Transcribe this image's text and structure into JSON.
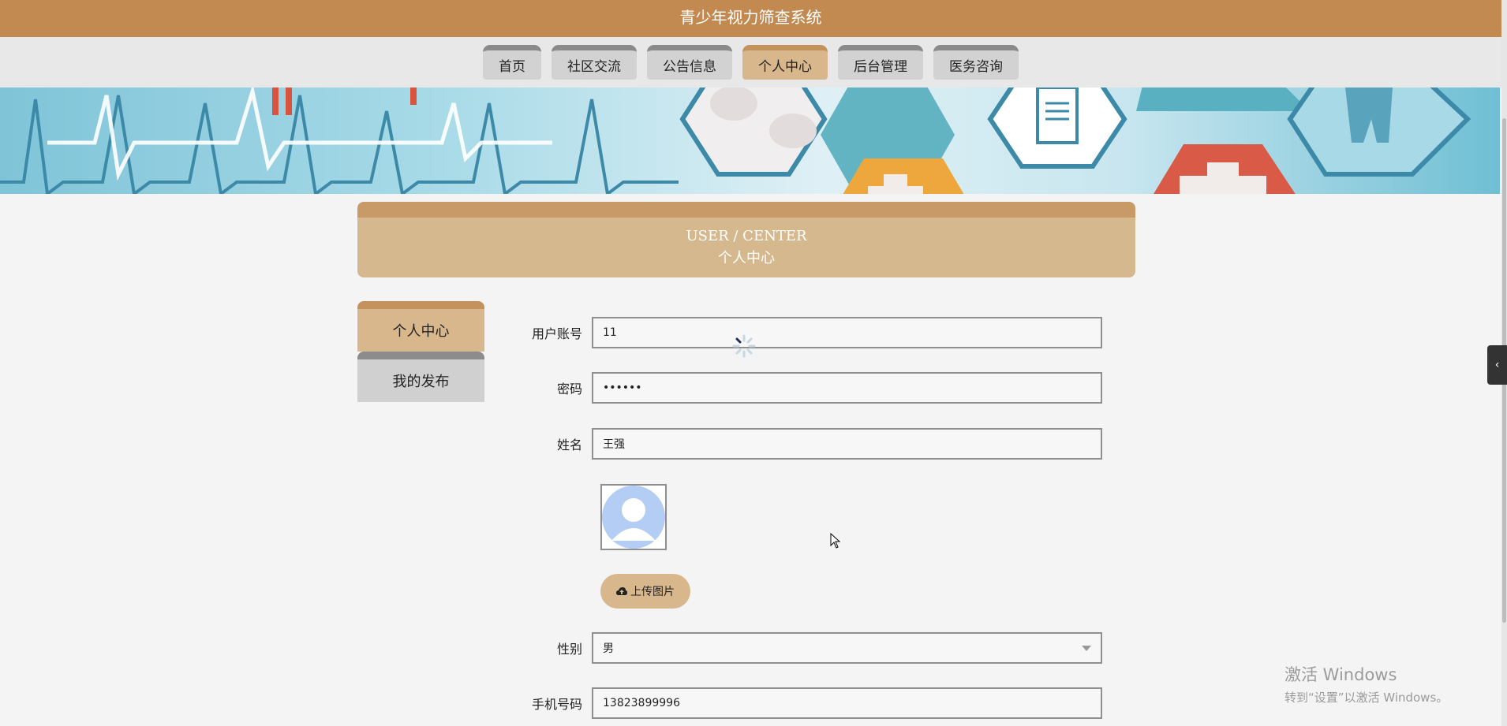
{
  "app": {
    "title": "青少年视力筛查系统"
  },
  "nav": {
    "items": [
      {
        "label": "首页"
      },
      {
        "label": "社区交流"
      },
      {
        "label": "公告信息"
      },
      {
        "label": "个人中心",
        "active": true
      },
      {
        "label": "后台管理"
      },
      {
        "label": "医务咨询"
      }
    ]
  },
  "center_header": {
    "en": "USER / CENTER",
    "zh": "个人中心"
  },
  "side_menu": {
    "items": [
      {
        "label": "个人中心",
        "active": true
      },
      {
        "label": "我的发布"
      }
    ]
  },
  "form": {
    "username": {
      "label": "用户账号",
      "value": "11"
    },
    "password": {
      "label": "密码",
      "value": "••••••"
    },
    "name": {
      "label": "姓名",
      "value": "王强"
    },
    "upload_label": "上传图片",
    "gender": {
      "label": "性别",
      "value": "男"
    },
    "phone": {
      "label": "手机号码",
      "value": "13823899996"
    }
  },
  "watermark": {
    "line1": "激活 Windows",
    "line2": "转到“设置”以激活 Windows。"
  },
  "colors": {
    "brand": "#c28a51",
    "accent": "#d8b78d",
    "inactive": "#d2d2d2"
  }
}
